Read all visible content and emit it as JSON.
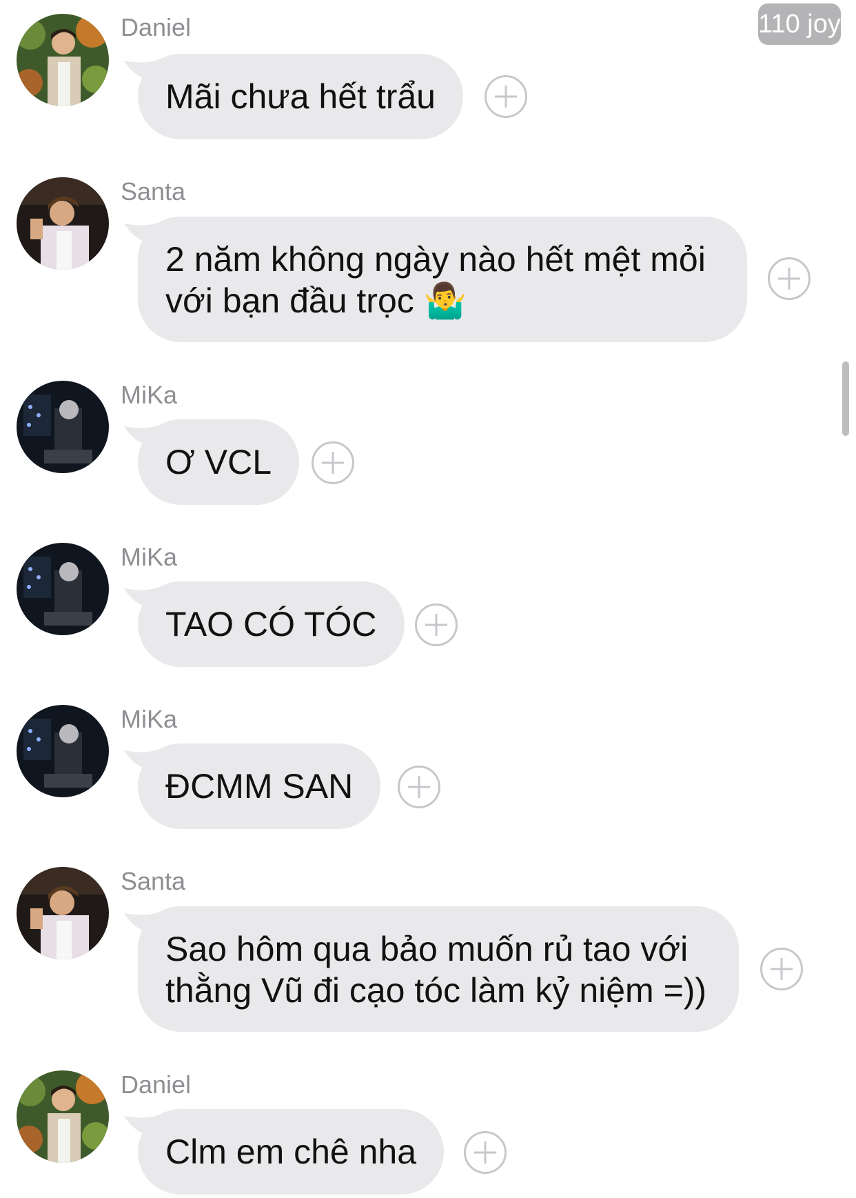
{
  "badge": {
    "label": "110 joy"
  },
  "messages": [
    {
      "sender": "Daniel",
      "avatar": "daniel-avatar",
      "lines": [
        "Mãi chưa hết trẩu"
      ]
    },
    {
      "sender": "Santa",
      "avatar": "santa-avatar",
      "lines": [
        "2 năm không ngày nào hết mệt mỏi",
        "với bạn đầu trọc 🤷‍♂️"
      ]
    },
    {
      "sender": "MiKa",
      "avatar": "mika-avatar",
      "lines": [
        "Ơ VCL"
      ]
    },
    {
      "sender": "MiKa",
      "avatar": "mika-avatar",
      "lines": [
        "TAO CÓ TÓC"
      ]
    },
    {
      "sender": "MiKa",
      "avatar": "mika-avatar",
      "lines": [
        "ĐCMM SAN"
      ]
    },
    {
      "sender": "Santa",
      "avatar": "santa-avatar",
      "lines": [
        "Sao hôm qua bảo muốn rủ tao với",
        "thằng Vũ đi cạo tóc làm kỷ niệm =))"
      ]
    },
    {
      "sender": "Daniel",
      "avatar": "daniel-avatar",
      "lines": [
        "Clm em chê nha"
      ]
    }
  ],
  "colors": {
    "bubble": "#e9e9eb",
    "sender": "#8e8e93",
    "badge": "#b4b4b6",
    "reaction_icon": "#c7c7cc"
  }
}
